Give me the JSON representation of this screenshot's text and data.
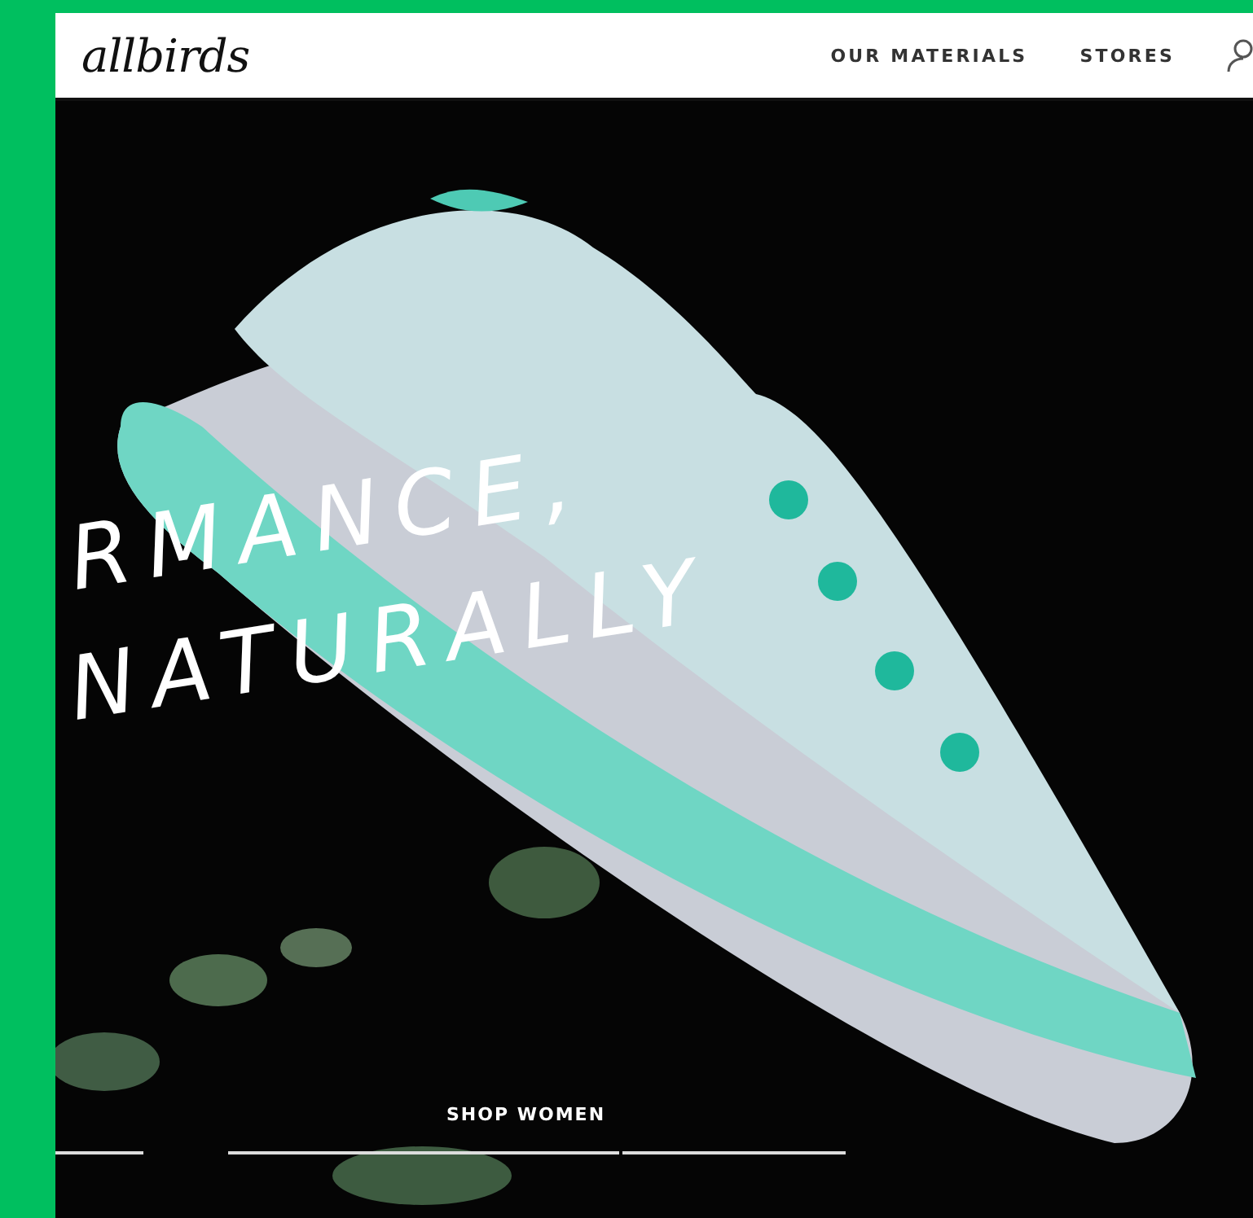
{
  "header": {
    "logo": "allbirds",
    "nav": [
      {
        "label": "OUR MATERIALS"
      },
      {
        "label": "STORES"
      }
    ]
  },
  "hero": {
    "headline": [
      "RMANCE,",
      "NATURALLY"
    ],
    "cta": "SHOP WOMEN"
  }
}
